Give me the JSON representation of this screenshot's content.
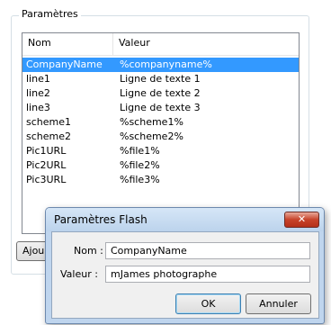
{
  "groupbox": {
    "title": "Paramètres"
  },
  "list": {
    "columns": [
      "Nom",
      "Valeur"
    ],
    "rows": [
      {
        "name": "CompanyName",
        "value": "%companyname%",
        "selected": true
      },
      {
        "name": "line1",
        "value": "Ligne de texte 1"
      },
      {
        "name": "line2",
        "value": "Ligne de texte 2"
      },
      {
        "name": "line3",
        "value": "Ligne de texte 3"
      },
      {
        "name": "scheme1",
        "value": "%scheme1%"
      },
      {
        "name": "scheme2",
        "value": "%scheme2%"
      },
      {
        "name": "Pic1URL",
        "value": "%file1%"
      },
      {
        "name": "Pic2URL",
        "value": "%file2%"
      },
      {
        "name": "Pic3URL",
        "value": "%file3%"
      }
    ]
  },
  "buttons": {
    "add_partial": "Ajou"
  },
  "dialog": {
    "title": "Paramètres Flash",
    "close_glyph": "✕",
    "nom_label": "Nom :",
    "nom_value": "CompanyName",
    "valeur_label": "Valeur :",
    "valeur_value": "mJames photographe",
    "ok_label": "OK",
    "cancel_label": "Annuler"
  },
  "colors": {
    "selection": "#3399ff",
    "dialog_frame": "#bfd5ee",
    "close_button": "#c7432a"
  }
}
